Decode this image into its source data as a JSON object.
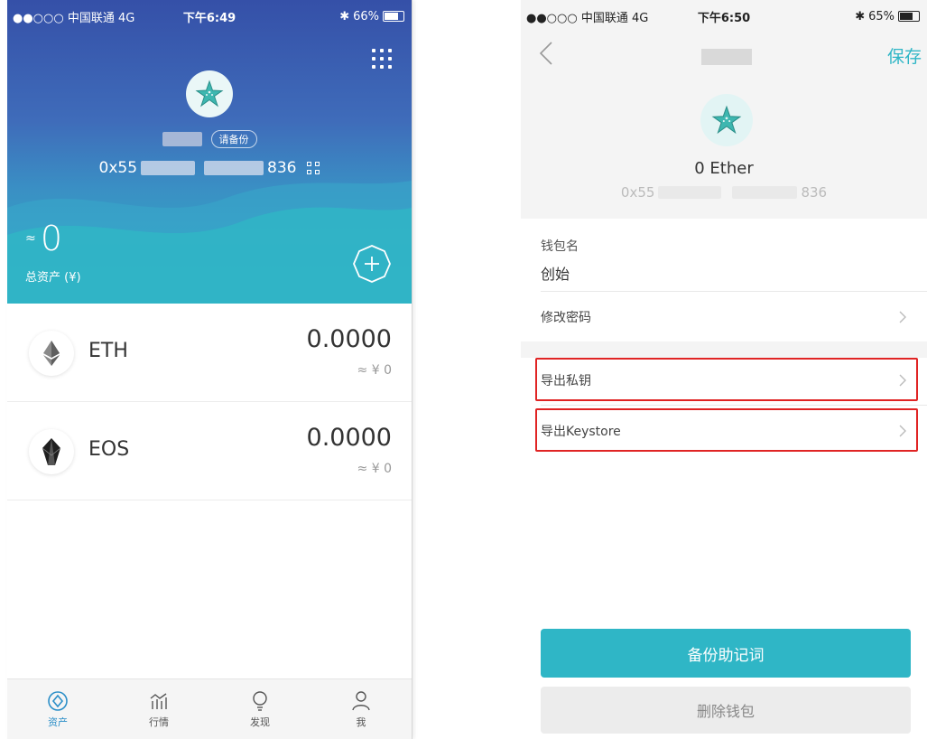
{
  "left_screen": {
    "status_bar": {
      "carrier": "●●○○○ 中国联通  4G",
      "time": "下午6:49",
      "battery": "66%"
    },
    "wallet": {
      "backup_badge": "请备份",
      "address_prefix": "0x55",
      "address_suffix": "836"
    },
    "total_assets": {
      "approx_symbol": "≈",
      "value": "0",
      "label": "总资产 (¥)"
    },
    "assets": [
      {
        "symbol": "ETH",
        "icon": "ethereum-icon",
        "amount": "0.0000",
        "cny": "≈ ¥ 0"
      },
      {
        "symbol": "EOS",
        "icon": "eos-icon",
        "amount": "0.0000",
        "cny": "≈ ¥ 0"
      }
    ],
    "tabs": [
      {
        "label": "资产",
        "icon": "assets-icon",
        "active": true
      },
      {
        "label": "行情",
        "icon": "market-icon",
        "active": false
      },
      {
        "label": "发现",
        "icon": "discover-icon",
        "active": false
      },
      {
        "label": "我",
        "icon": "profile-icon",
        "active": false
      }
    ]
  },
  "right_screen": {
    "status_bar": {
      "carrier": "●●○○○ 中国联通  4G",
      "time": "下午6:50",
      "battery": "65%"
    },
    "header": {
      "save_label": "保存"
    },
    "wallet": {
      "balance": "0 Ether",
      "address_prefix": "0x55",
      "address_suffix": "836"
    },
    "wallet_name": {
      "label": "钱包名",
      "value": "创始"
    },
    "menu": {
      "change_password": "修改密码",
      "export_private_key": "导出私钥",
      "export_keystore": "导出Keystore"
    },
    "buttons": {
      "backup_mnemonic": "备份助记词",
      "delete_wallet": "删除钱包"
    }
  },
  "colors": {
    "accent": "#2fb6c6",
    "highlight": "#e02424",
    "hero_top": "#3550a8",
    "hero_bottom": "#2fb6c6"
  }
}
